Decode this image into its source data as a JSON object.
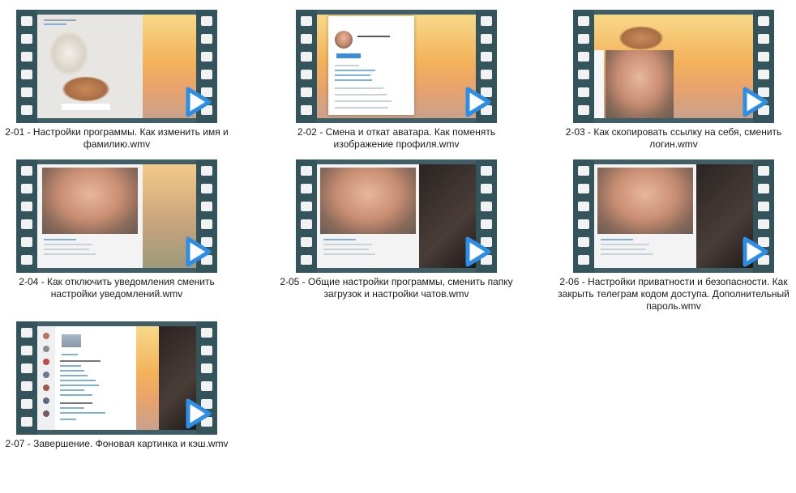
{
  "videos": [
    {
      "label": "2-01 - Настройки программы. Как изменить имя и фамилию.wmv"
    },
    {
      "label": "2-02 - Смена и откат аватара. Как поменять изображение профиля.wmv"
    },
    {
      "label": "2-03 - Как скопировать ссылку на себя, сменить логин.wmv"
    },
    {
      "label": "2-04 - Как отключить уведомления сменить настройки уведомлений.wmv"
    },
    {
      "label": "2-05 - Общие настройки программы, сменить папку загрузок и настройки чатов.wmv"
    },
    {
      "label": "2-06 - Настройки приватности и безопасности. Как закрыть телеграм кодом доступа. Дополнительный пароль.wmv"
    },
    {
      "label": "2-07 - Завершение. Фоновая картинка и кэш.wmv"
    }
  ],
  "icons": {
    "film": "film-strip-icon",
    "play": "play-overlay-icon"
  },
  "colors": {
    "film": "#34545c",
    "play": "#2e8ee6",
    "caption": "#1a1a1a"
  }
}
